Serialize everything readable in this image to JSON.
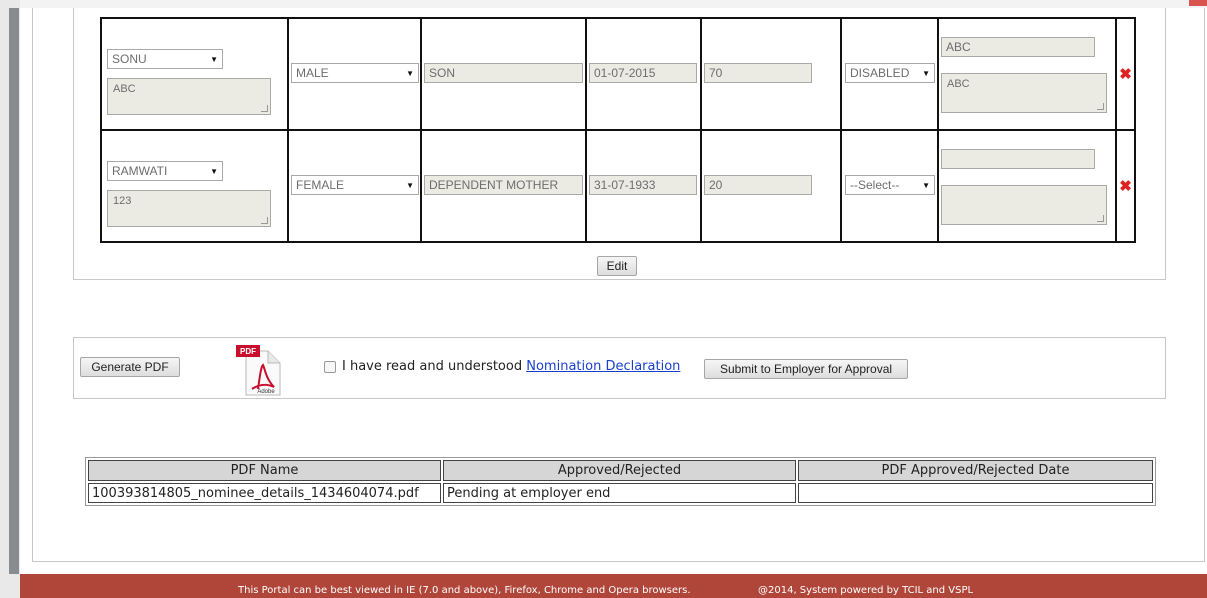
{
  "nominees": [
    {
      "name": "SONU",
      "address": "ABC",
      "gender": "MALE",
      "relation": "SON",
      "dob": "01-07-2015",
      "share": "70",
      "status": "DISABLED",
      "guardian_name": "ABC",
      "guardian_address": "ABC"
    },
    {
      "name": "RAMWATI",
      "address": "123",
      "gender": "FEMALE",
      "relation": "DEPENDENT MOTHER",
      "dob": "31-07-1933",
      "share": "20",
      "status": "--Select--",
      "guardian_name": "",
      "guardian_address": ""
    }
  ],
  "edit_label": "Edit",
  "actions": {
    "generate_pdf_label": "Generate PDF",
    "pdf_icon_badge": "PDF",
    "pdf_icon_brand": "Adobe",
    "declaration_text": "I have read and understood",
    "declaration_link": "Nomination Declaration",
    "submit_label": "Submit to Employer for Approval"
  },
  "pdf_table": {
    "headers": [
      "PDF Name",
      "Approved/Rejected",
      "PDF Approved/Rejected Date"
    ],
    "rows": [
      [
        "100393814805_nominee_details_1434604074.pdf",
        "Pending at employer end",
        ""
      ]
    ]
  },
  "footer": {
    "browsers_text": "This Portal can be best viewed in IE (7.0 and above), Firefox, Chrome and Opera browsers.",
    "copyright_text": "@2014, System powered by TCIL and VSPL"
  },
  "colors": {
    "footer_bg": "#b0463a",
    "link": "#1a3fcf",
    "delete_icon": "#dd2222"
  }
}
